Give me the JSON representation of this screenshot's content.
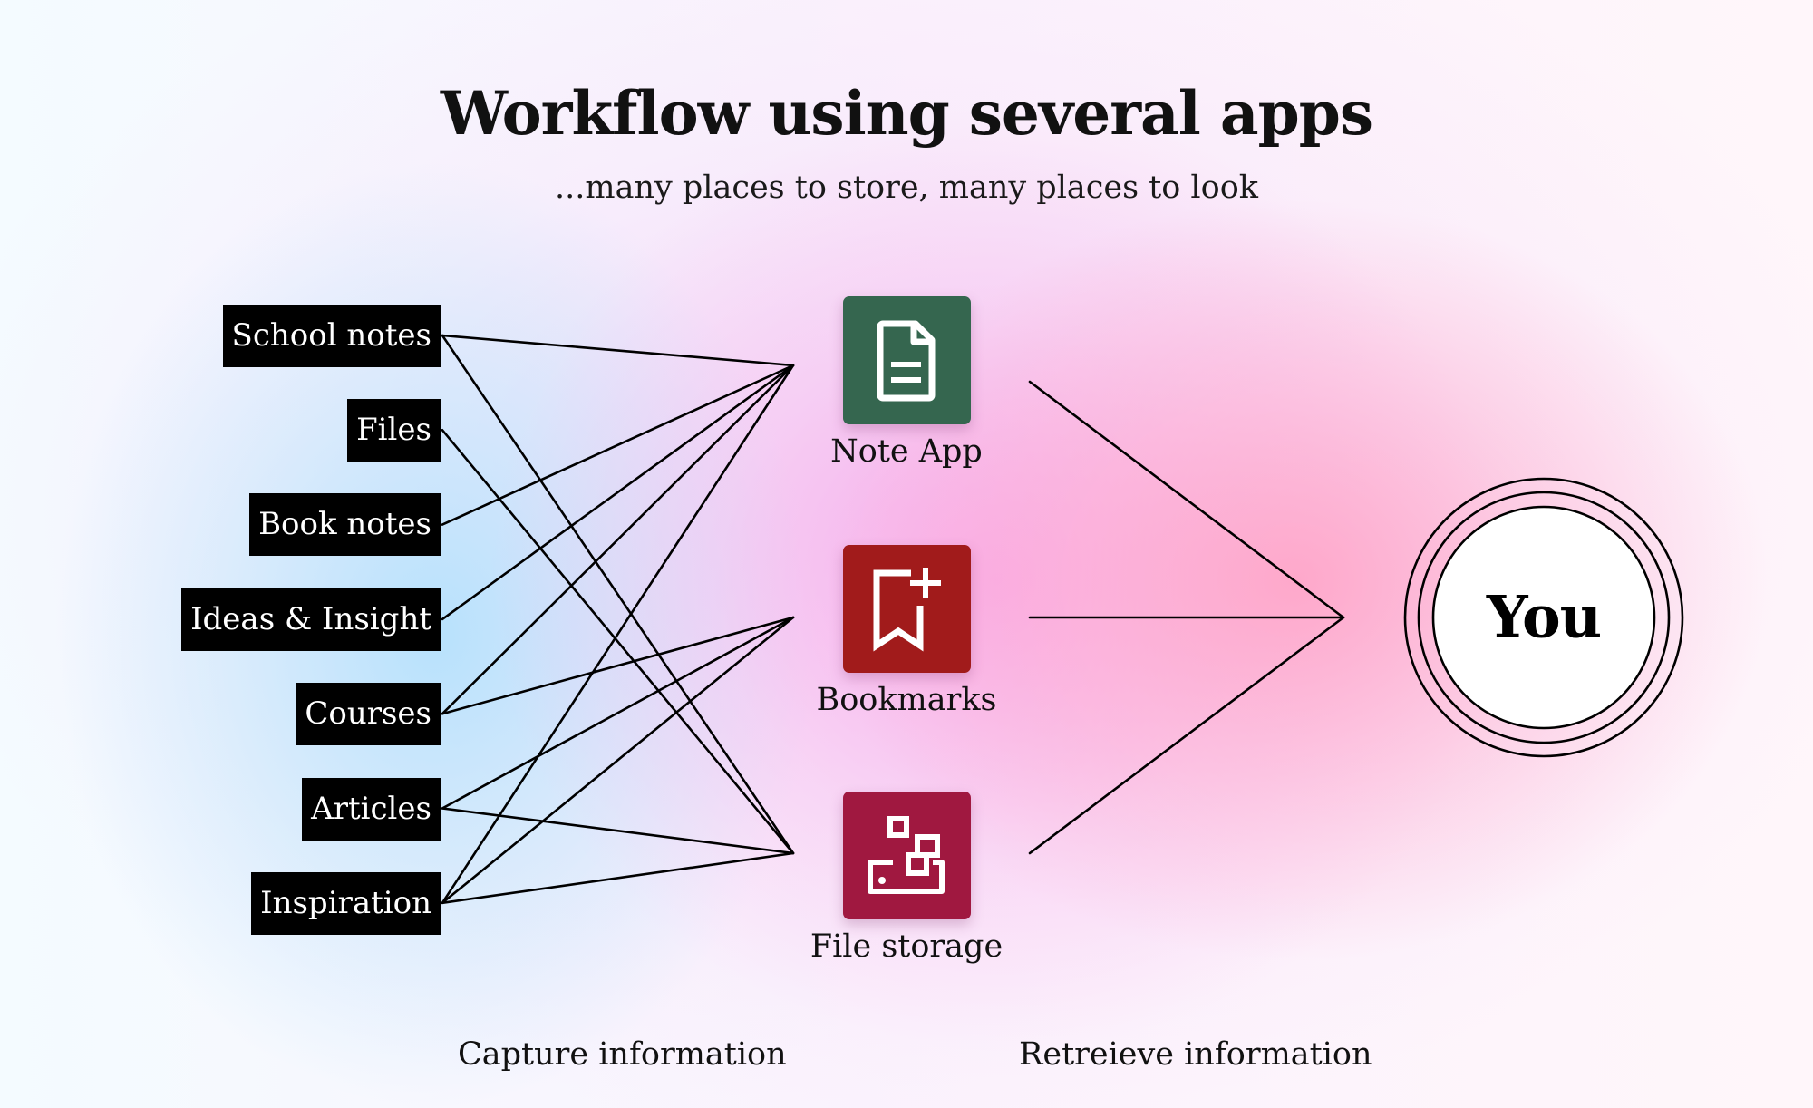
{
  "header": {
    "title": "Workflow using several apps",
    "subtitle": "...many places to store, many places to look"
  },
  "sources": [
    {
      "id": "school-notes",
      "label": "School notes",
      "targets": [
        "note-app",
        "file-storage"
      ]
    },
    {
      "id": "files",
      "label": "Files",
      "targets": [
        "file-storage"
      ]
    },
    {
      "id": "book-notes",
      "label": "Book notes",
      "targets": [
        "note-app"
      ]
    },
    {
      "id": "ideas-insight",
      "label": "Ideas & Insight",
      "targets": [
        "note-app"
      ]
    },
    {
      "id": "courses",
      "label": "Courses",
      "targets": [
        "note-app",
        "bookmarks"
      ]
    },
    {
      "id": "articles",
      "label": "Articles",
      "targets": [
        "bookmarks",
        "file-storage"
      ]
    },
    {
      "id": "inspiration",
      "label": "Inspiration",
      "targets": [
        "note-app",
        "bookmarks",
        "file-storage"
      ]
    }
  ],
  "apps": [
    {
      "id": "note-app",
      "label": "Note App",
      "icon": "document-icon",
      "color": "#35664F"
    },
    {
      "id": "bookmarks",
      "label": "Bookmarks",
      "icon": "bookmark-add-icon",
      "color": "#A11B1B"
    },
    {
      "id": "file-storage",
      "label": "File storage",
      "icon": "storage-blocks-icon",
      "color": "#A01840"
    }
  ],
  "destination": {
    "label": "You",
    "sources": [
      "note-app",
      "bookmarks",
      "file-storage"
    ]
  },
  "footer": {
    "capture_label": "Capture information",
    "retrieve_label": "Retreieve information"
  }
}
